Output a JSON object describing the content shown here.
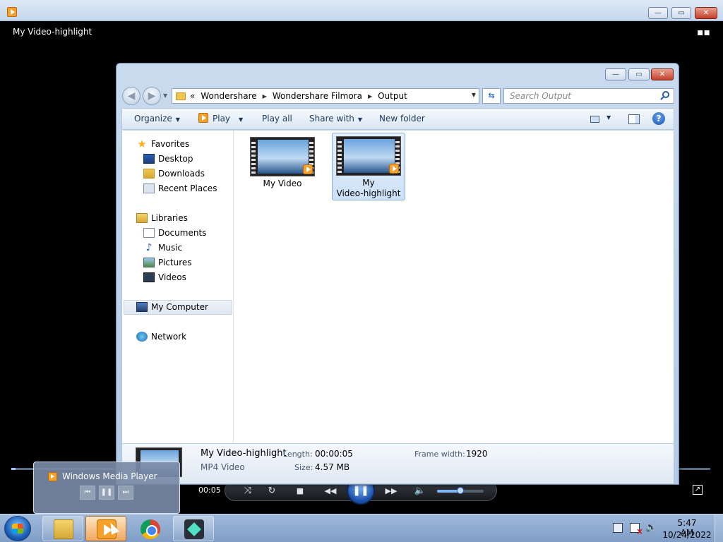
{
  "wmp": {
    "window_title": "My Video-highlight",
    "elapsed_time": "00:05",
    "volume_level": 0.5,
    "seek_progress": 0.006,
    "controls": {
      "shuffle": "⤨",
      "repeat": "↻",
      "stop": "■",
      "previous": "◀◀",
      "play_pause": "❚❚",
      "next": "▶▶",
      "mute": "🔈"
    },
    "switch_icon": "▪▪",
    "fullscreen_icon": "↗"
  },
  "explorer": {
    "breadcrumb": {
      "overflow": "«",
      "items": [
        "Wondershare",
        "Wondershare Filmora",
        "Output"
      ],
      "separator": "▶"
    },
    "search_placeholder": "Search Output",
    "toolbar": {
      "organize": "Organize",
      "play": "Play",
      "play_all": "Play all",
      "share_with": "Share with",
      "new_folder": "New folder",
      "caret": "▼"
    },
    "nav": {
      "favorites": "Favorites",
      "desktop": "Desktop",
      "downloads": "Downloads",
      "recent_places": "Recent Places",
      "libraries": "Libraries",
      "documents": "Documents",
      "music": "Music",
      "pictures": "Pictures",
      "videos": "Videos",
      "my_computer": "My Computer",
      "network": "Network"
    },
    "files": [
      {
        "name_line1": "My Video",
        "name_line2": ""
      },
      {
        "name_line1": "My",
        "name_line2": "Video-highlight"
      }
    ],
    "details": {
      "name": "My Video-highlight",
      "type": "MP4 Video",
      "length_label": "Length:",
      "length_value": "00:00:05",
      "size_label": "Size:",
      "size_value": "4.57 MB",
      "frame_width_label": "Frame width:",
      "frame_width_value": "1920"
    }
  },
  "thumbnail_popup": {
    "title": "Windows Media Player",
    "prev": "⏮",
    "pause": "❚❚",
    "next": "⏭"
  },
  "taskbar": {
    "clock_time": "5:47 AM",
    "clock_date": "10/24/2022",
    "volume_icon": "🔈"
  },
  "caption": {
    "minimize": "—",
    "maximize": "▭",
    "close": "✕",
    "back": "◀",
    "forward": "▶",
    "recent": "▼",
    "refresh": "⇆"
  }
}
